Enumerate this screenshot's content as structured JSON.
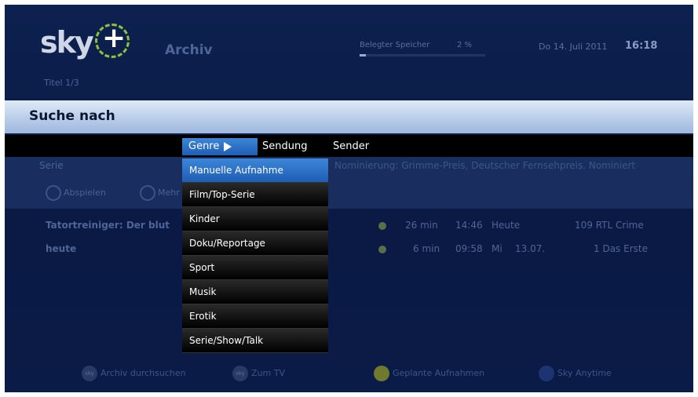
{
  "header": {
    "logo_text": "sky",
    "logo_plus": "+",
    "app_title": "Archiv",
    "storage_label": "Belegter Speicher",
    "storage_value": "2 %",
    "storage_fraction": 0.02,
    "date": "Do 14. Juli 2011",
    "time": "16:18",
    "title_count": "Titel 1/3"
  },
  "search": {
    "title": "Suche nach",
    "tabs": [
      {
        "label": "Genre"
      },
      {
        "label": "Sendung"
      },
      {
        "label": "Sender"
      }
    ]
  },
  "background": {
    "serie_label": "Serie",
    "info_text": "Nominierung: Grimme-Preis, Deutscher Fernsehpreis. Nominiert",
    "btn1": "Abspielen",
    "btn2": "Mehr"
  },
  "recordings": [
    {
      "title": "Tatortreiniger: Der blut",
      "duration": "26 min",
      "start": "14:46",
      "day": "Heute",
      "date": "",
      "channel": "109 RTL Crime"
    },
    {
      "title": "heute",
      "duration": "6 min",
      "start": "09:58",
      "day": "Mi",
      "date": "13.07.",
      "channel": "1 Das Erste"
    }
  ],
  "genre_menu": [
    "Manuelle Aufnahme",
    "Film/Top-Serie",
    "Kinder",
    "Doku/Reportage",
    "Sport",
    "Musik",
    "Erotik",
    "Serie/Show/Talk"
  ],
  "footer": {
    "btn_search": "Archiv durchsuchen",
    "btn_search_icon": "sky",
    "btn_tv": "Zum TV",
    "btn_tv_icon": "sky",
    "btn_planned": "Geplante Aufnahmen",
    "btn_anytime": "Sky Anytime"
  },
  "colors": {
    "accent": "#2f74c8",
    "green_button": "#8a9a2a",
    "blue_button": "#1a3a8a"
  }
}
